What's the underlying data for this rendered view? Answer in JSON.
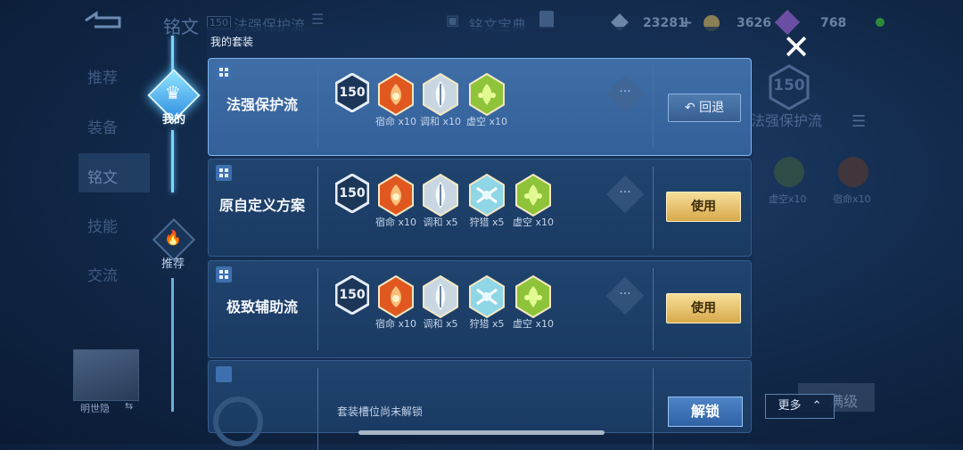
{
  "header": {
    "title": "铭文",
    "level": "150",
    "set_name": "法强保护流",
    "tab": "铭文宝典",
    "currencies": [
      {
        "icon": "diamond-icon",
        "value": "23281"
      },
      {
        "icon": "coin-icon",
        "value": "3626"
      },
      {
        "icon": "gem-icon",
        "value": "768"
      }
    ]
  },
  "sidebar_bg": [
    "推荐",
    "装备",
    "铭文",
    "技能",
    "交流"
  ],
  "hero": {
    "name": "明世隐"
  },
  "nav": {
    "mine": "我的",
    "recommend": "推荐"
  },
  "modal": {
    "title": "我的套装"
  },
  "cards": [
    {
      "name": "法强保护流",
      "level": "150",
      "selected": true,
      "button": "回退",
      "runes": [
        {
          "label": "宿命 x10",
          "color": "#e0581f",
          "kind": "fate"
        },
        {
          "label": "调和 x10",
          "color": "#c9d7e3",
          "kind": "harmony"
        },
        {
          "label": "虚空 x10",
          "color": "#8fc33a",
          "kind": "void"
        }
      ]
    },
    {
      "name": "原自定义方案",
      "level": "150",
      "selected": false,
      "button": "使用",
      "runes": [
        {
          "label": "宿命 x10",
          "color": "#e0581f",
          "kind": "fate"
        },
        {
          "label": "调和 x5",
          "color": "#c9d7e3",
          "kind": "harmony"
        },
        {
          "label": "狩猎 x5",
          "color": "#8fd6e6",
          "kind": "hunt"
        },
        {
          "label": "虚空 x10",
          "color": "#8fc33a",
          "kind": "void"
        }
      ]
    },
    {
      "name": "极致辅助流",
      "level": "150",
      "selected": false,
      "button": "使用",
      "runes": [
        {
          "label": "宿命 x10",
          "color": "#e0581f",
          "kind": "fate"
        },
        {
          "label": "调和 x5",
          "color": "#c9d7e3",
          "kind": "harmony"
        },
        {
          "label": "狩猎 x5",
          "color": "#8fd6e6",
          "kind": "hunt"
        },
        {
          "label": "虚空 x10",
          "color": "#8fc33a",
          "kind": "void"
        }
      ]
    }
  ],
  "locked_slot": {
    "text": "套装槽位尚未解锁",
    "button": "解锁"
  },
  "more_button": "更多",
  "right_preview": {
    "level": "150",
    "name": "法强保护流",
    "runes": [
      "虚空x10",
      "宿命x10"
    ],
    "button_partial": "满级"
  }
}
